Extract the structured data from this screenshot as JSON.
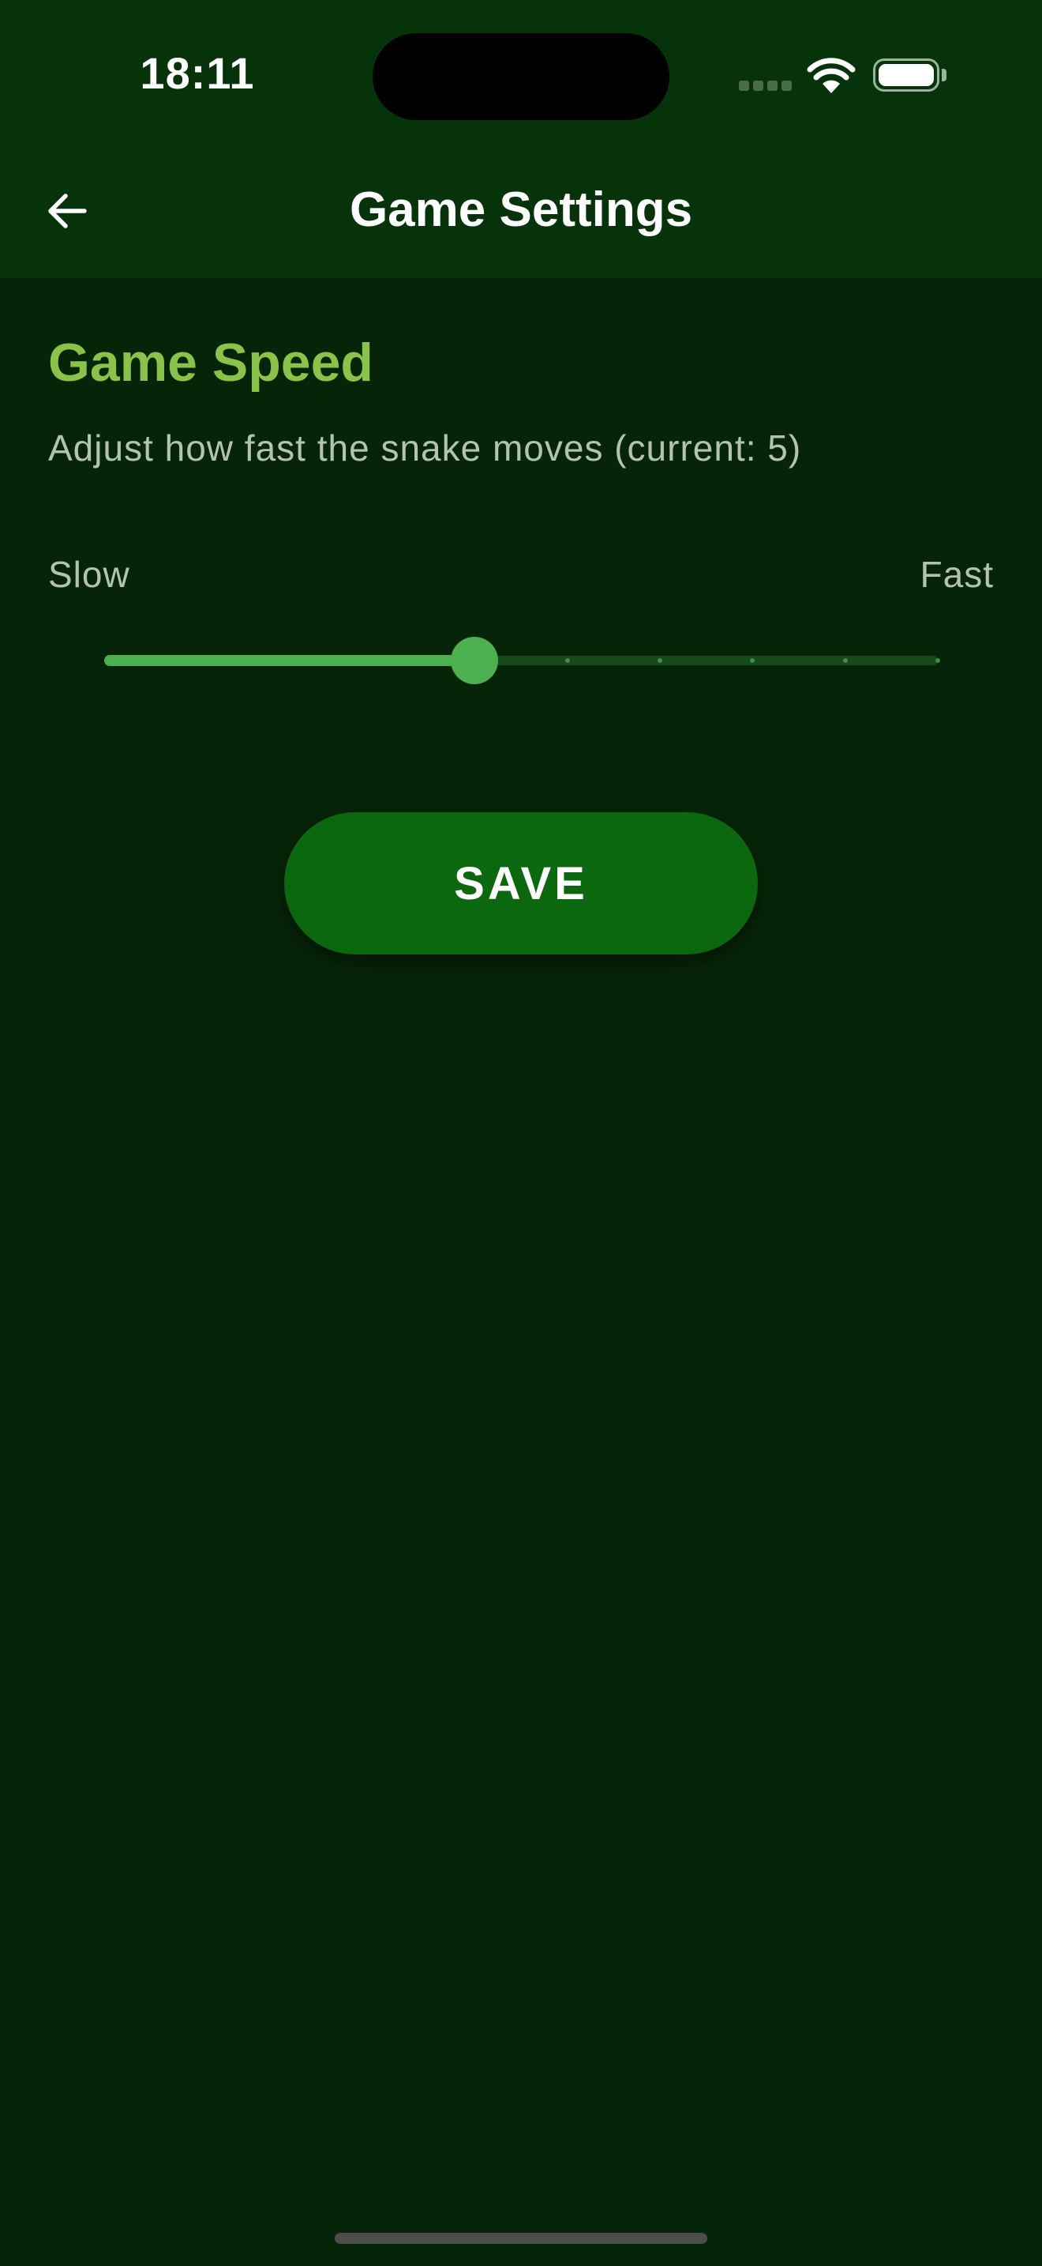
{
  "status_bar": {
    "time": "18:11",
    "icons": [
      "cellular-signal-icon",
      "wifi-icon",
      "battery-icon"
    ]
  },
  "header": {
    "back_icon": "arrow-left-icon",
    "title": "Game Settings"
  },
  "speed_section": {
    "title": "Game Speed",
    "description": "Adjust how fast the snake moves (current: 5)",
    "min_label": "Slow",
    "max_label": "Fast",
    "slider": {
      "min": 1,
      "max": 10,
      "value": 5
    }
  },
  "save_button": {
    "label": "SAVE"
  },
  "colors": {
    "background": "#062508",
    "app_bar": "#07330b",
    "accent": "#8bc34a",
    "slider_active": "#4caf50",
    "button": "#0b680f"
  }
}
